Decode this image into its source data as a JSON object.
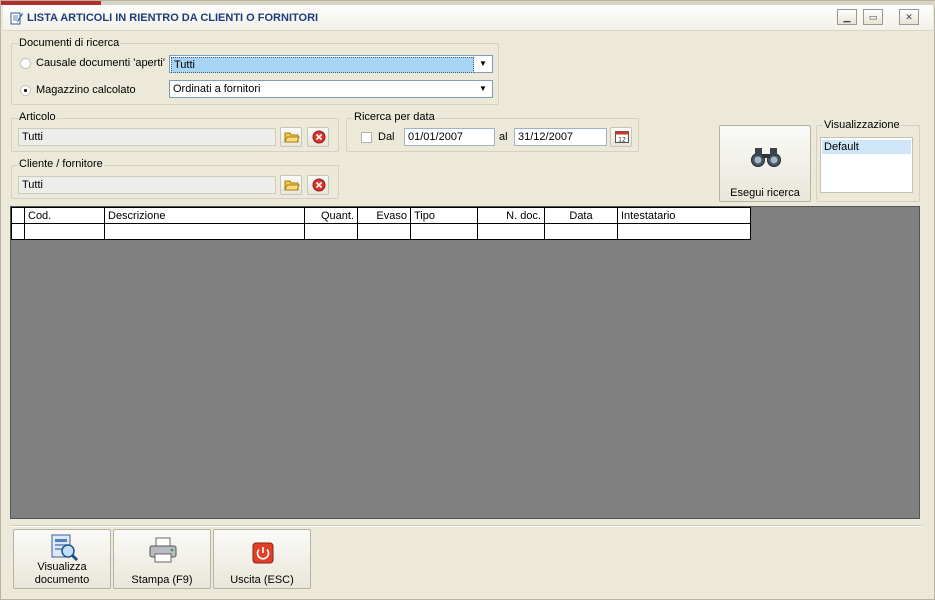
{
  "window": {
    "title": "LISTA ARTICOLI IN RIENTRO DA CLIENTI O FORNITORI",
    "controls": [
      "minimize-icon",
      "maximize-icon",
      "close-icon"
    ]
  },
  "documenti": {
    "group_label": "Documenti di ricerca",
    "causale_label": "Causale documenti 'aperti'",
    "causale_value": "Tutti",
    "magazzino_label": "Magazzino calcolato",
    "magazzino_value": "Ordinati a fornitori",
    "selected_option": "magazzino"
  },
  "articolo": {
    "group_label": "Articolo",
    "value": "Tutti"
  },
  "ricerca_data": {
    "group_label": "Ricerca per data",
    "dal_label": "Dal",
    "dal_value": "01/01/2007",
    "al_label": "al",
    "al_value": "31/12/2007",
    "checked": false
  },
  "cliente": {
    "group_label": "Cliente / fornitore",
    "value": "Tutti"
  },
  "esegui": {
    "label": "Esegui ricerca",
    "icon": "binoculars-icon"
  },
  "visualizzazione": {
    "group_label": "Visualizzazione",
    "items": [
      "Default"
    ]
  },
  "grid": {
    "columns": [
      "Cod.",
      "Descrizione",
      "Quant.",
      "Evaso",
      "Tipo",
      "N. doc.",
      "Data",
      "Intestatario"
    ],
    "rows": [
      [
        "",
        "",
        "",
        "",
        "",
        "",
        "",
        ""
      ]
    ]
  },
  "toolbar": {
    "visualizza_line1": "Visualizza",
    "visualizza_line2": "documento",
    "stampa_label": "Stampa (F9)",
    "uscita_label": "Uscita (ESC)"
  },
  "colors": {
    "title_text": "#1f3d7a",
    "grid_background": "#808080",
    "window_background": "#ece9d8",
    "selection": "#a9d5f5",
    "exit_red": "#e0402a"
  }
}
